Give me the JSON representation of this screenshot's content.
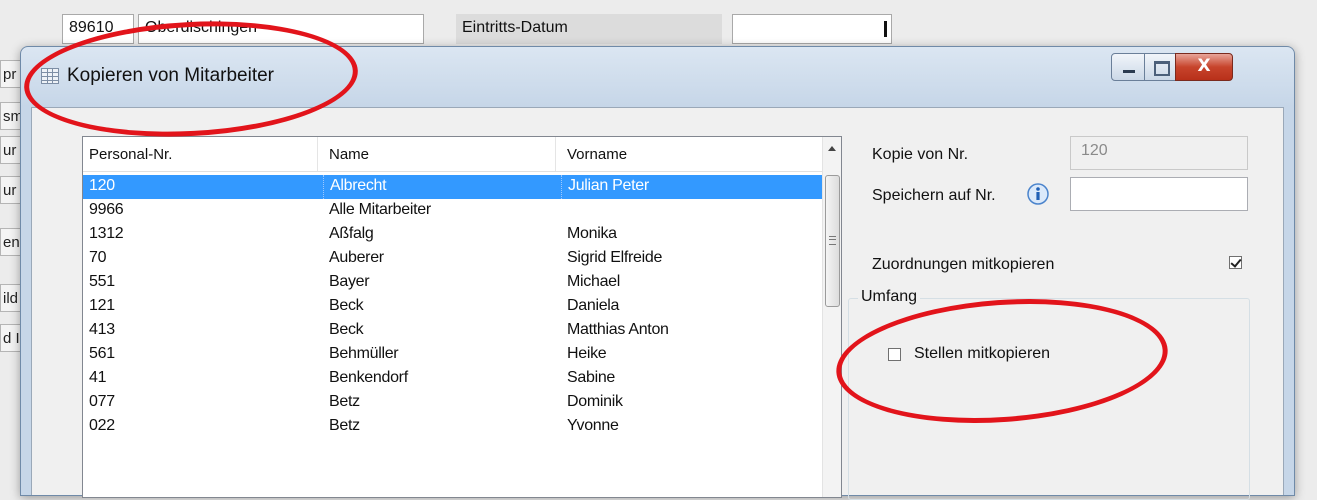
{
  "background": {
    "number_value": "89610",
    "place_value": "Oberdischingen",
    "entry_date_label": "Eintritts-Datum",
    "left_stubs": [
      "pr",
      "sm",
      "ur",
      "ur",
      "en",
      "ild",
      "d I"
    ]
  },
  "dialog": {
    "title": "Kopieren von Mitarbeiter",
    "close_glyph": "X"
  },
  "list": {
    "columns": [
      "Personal-Nr.",
      "Name",
      "Vorname"
    ],
    "rows": [
      {
        "nr": "120",
        "name": "Albrecht",
        "vorname": "Julian Peter",
        "selected": true
      },
      {
        "nr": "9966",
        "name": "Alle Mitarbeiter",
        "vorname": ""
      },
      {
        "nr": "1312",
        "name": "Aßfalg",
        "vorname": "Monika"
      },
      {
        "nr": "70",
        "name": "Auberer",
        "vorname": "Sigrid Elfreide"
      },
      {
        "nr": "551",
        "name": "Bayer",
        "vorname": "Michael"
      },
      {
        "nr": "121",
        "name": "Beck",
        "vorname": "Daniela"
      },
      {
        "nr": "413",
        "name": "Beck",
        "vorname": "Matthias Anton"
      },
      {
        "nr": "561",
        "name": "Behmüller",
        "vorname": "Heike"
      },
      {
        "nr": "41",
        "name": "Benkendorf",
        "vorname": "Sabine"
      },
      {
        "nr": "077",
        "name": "Betz",
        "vorname": "Dominik"
      },
      {
        "nr": "022",
        "name": "Betz",
        "vorname": "Yvonne"
      }
    ]
  },
  "form": {
    "copy_from_label": "Kopie von Nr.",
    "copy_from_value": "120",
    "save_to_label": "Speichern auf Nr.",
    "save_to_value": "",
    "copy_assignments_label": "Zuordnungen mitkopieren",
    "copy_assignments_checked": true,
    "group_title": "Umfang",
    "copy_positions_label": "Stellen mitkopieren",
    "copy_positions_checked": false
  },
  "colors": {
    "selection": "#3399ff",
    "annotation": "#e2141b",
    "close_button": "#c7442c"
  }
}
